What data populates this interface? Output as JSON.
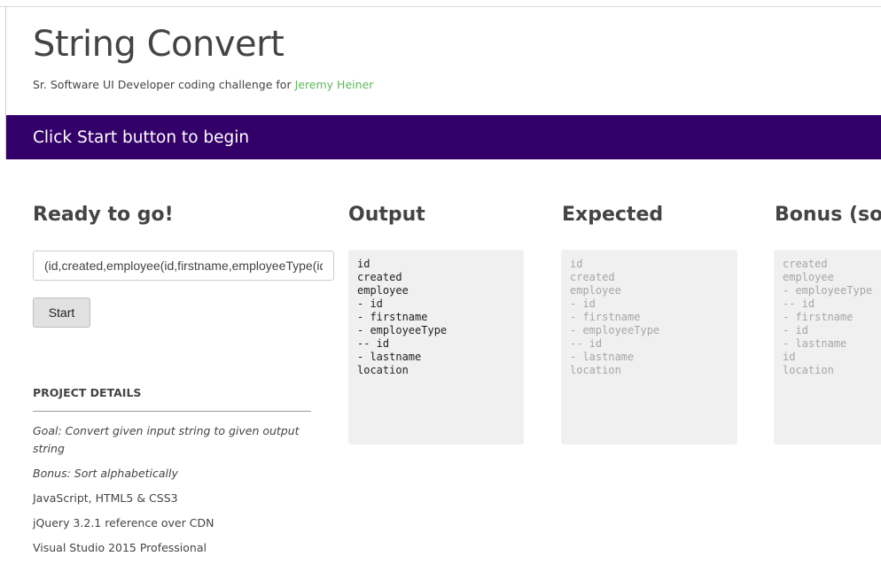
{
  "header": {
    "title": "String Convert",
    "subtitle_prefix": "Sr. Software UI Developer coding challenge for ",
    "author_link": "Jeremy Heiner"
  },
  "banner": {
    "text": "Click Start button to begin",
    "color": "#33006a"
  },
  "input_column": {
    "heading": "Ready to go!",
    "input_value": "(id,created,employee(id,firstname,employeeType(id),lastname),location)",
    "start_label": "Start"
  },
  "project_details": {
    "heading": "PROJECT DETAILS",
    "goal": "Goal: Convert given input string to given output string",
    "bonus": "Bonus: Sort alphabetically",
    "tech": "JavaScript, HTML5 & CSS3",
    "jquery": "jQuery 3.2.1 reference over CDN",
    "ide": "Visual Studio 2015 Professional"
  },
  "output": {
    "heading": "Output",
    "text": "id\ncreated\nemployee\n- id\n- firstname\n- employeeType\n-- id\n- lastname\nlocation"
  },
  "expected": {
    "heading": "Expected",
    "text": "id\ncreated\nemployee\n- id\n- firstname\n- employeeType\n-- id\n- lastname\nlocation"
  },
  "bonus": {
    "heading": "Bonus (sor",
    "text": "created\nemployee\n- employeeType\n-- id\n- firstname\n- id\n- lastname\nid\nlocation"
  },
  "colors": {
    "link": "#5cb85c",
    "code_background": "#f0f0f0"
  }
}
